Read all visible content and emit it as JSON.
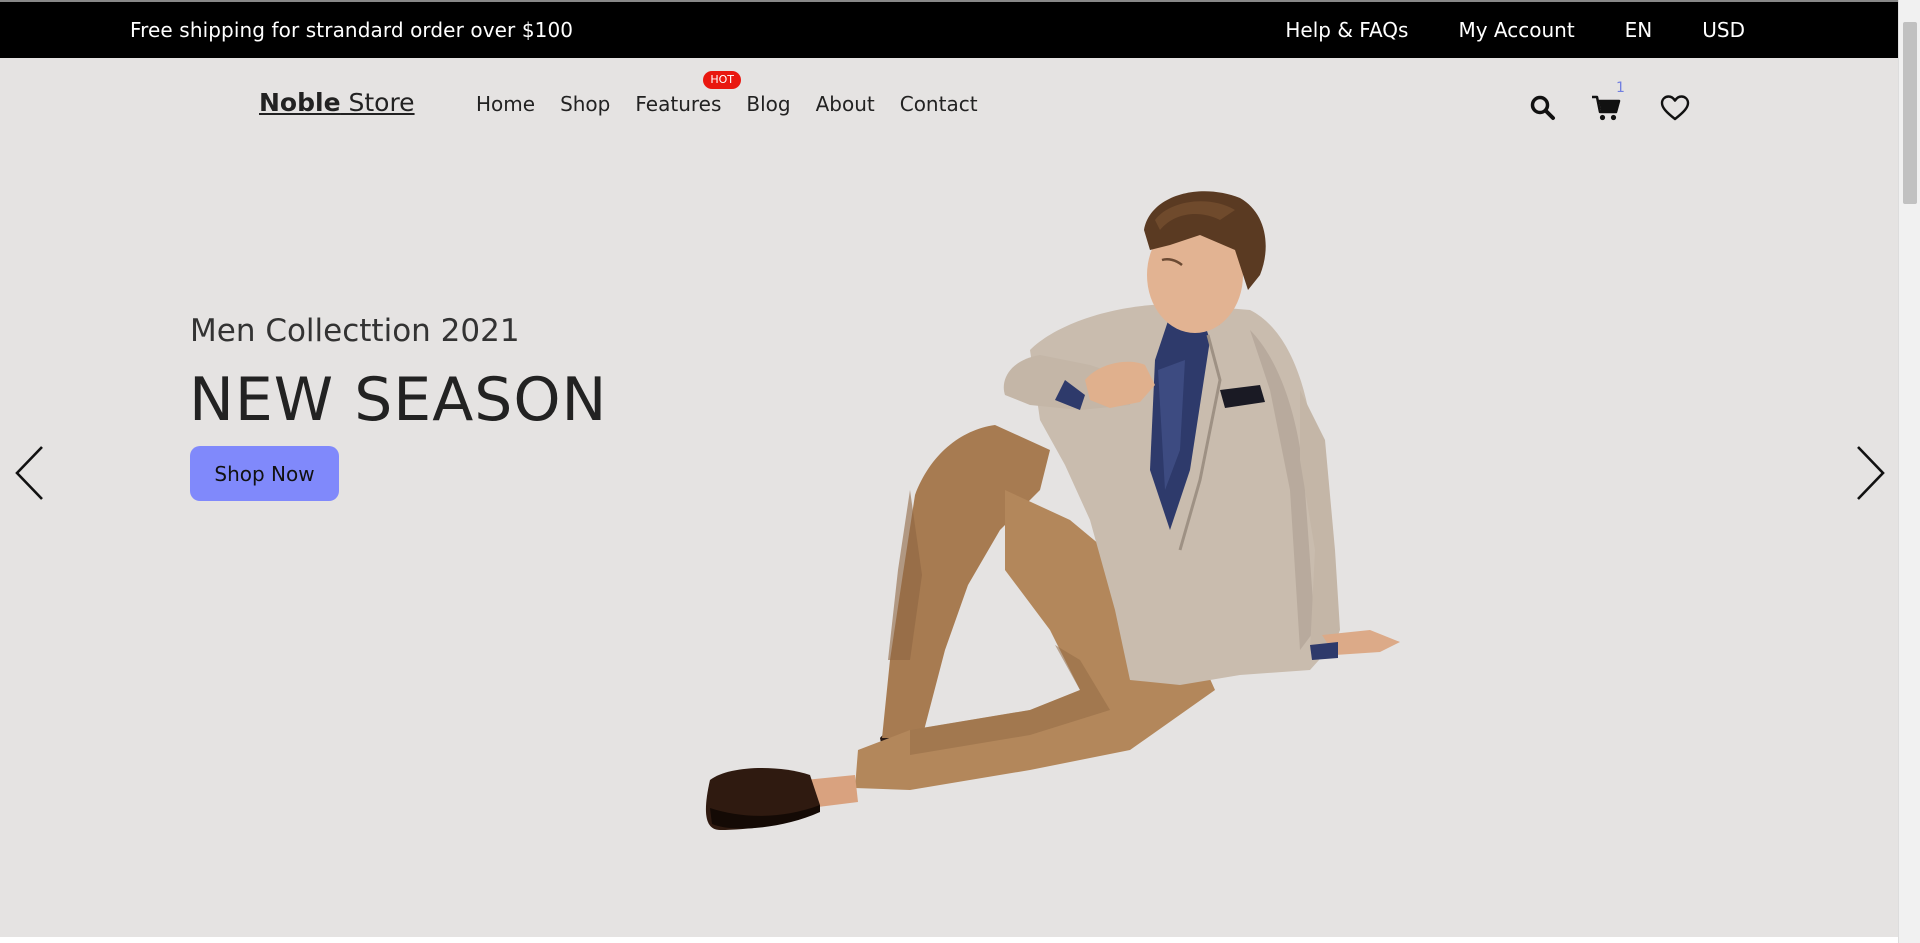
{
  "topbar": {
    "promo": "Free shipping for strandard order over $100",
    "links": [
      "Help & FAQs",
      "My Account",
      "EN",
      "USD"
    ]
  },
  "header": {
    "logo_bold": "Noble",
    "logo_rest": " Store",
    "nav": [
      "Home",
      "Shop",
      "Features",
      "Blog",
      "About",
      "Contact"
    ],
    "hot_badge": "HOT",
    "cart_count": "1",
    "icons": [
      "search-icon",
      "cart-icon",
      "heart-icon"
    ]
  },
  "hero": {
    "subtitle": "Men Collecttion 2021",
    "title": "NEW SEASON",
    "button": "Shop Now"
  },
  "colors": {
    "background": "#e5e3e2",
    "topbar": "#000000",
    "accent": "#8089fb",
    "hot": "#e9170f",
    "cart_count": "#717fe0"
  }
}
